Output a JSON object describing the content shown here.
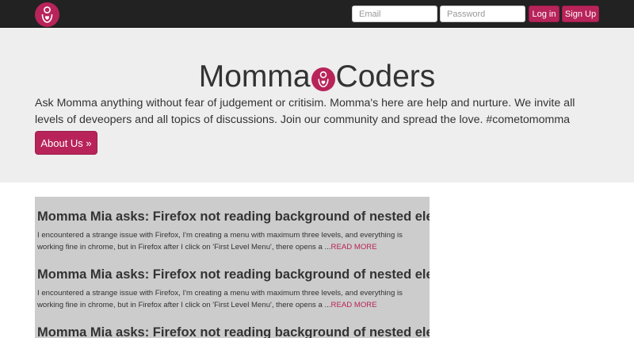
{
  "colors": {
    "accent": "#b8245a",
    "navbar": "#222222",
    "jumbotron": "#eeeeee",
    "feed_bg": "#cccccc"
  },
  "nav": {
    "logo_icon": "mother-and-child-logo-icon",
    "email_placeholder": "Email",
    "password_placeholder": "Password",
    "login_label": "Log in",
    "signup_label": "Sign Up"
  },
  "hero": {
    "title_left": "Momma",
    "title_right": "Coders",
    "title_icon": "mother-and-child-logo-icon",
    "intro": "Ask Momma anything without fear of judgement or critisim. Momma's here are help and nurture. We invite all levels of deveopers and all topics of discussions. Join our community and spread the love. #cometomomma",
    "about_button": "About Us »"
  },
  "posts": [
    {
      "title": "Momma Mia asks: Firefox not reading background of nested element.",
      "excerpt": "I encountered a strange issue with Firefox, I'm creating a menu with maximum three levels, and everything is working fine in chrome, but in Firefox after I click on 'First Level Menu', there opens a ...",
      "read_more": "READ MORE"
    },
    {
      "title": "Momma Mia asks: Firefox not reading background of nested element.",
      "excerpt": "I encountered a strange issue with Firefox, I'm creating a menu with maximum three levels, and everything is working fine in chrome, but in Firefox after I click on 'First Level Menu', there opens a ...",
      "read_more": "READ MORE"
    },
    {
      "title": "Momma Mia asks: Firefox not reading background of nested element.",
      "excerpt": "",
      "read_more": ""
    }
  ]
}
